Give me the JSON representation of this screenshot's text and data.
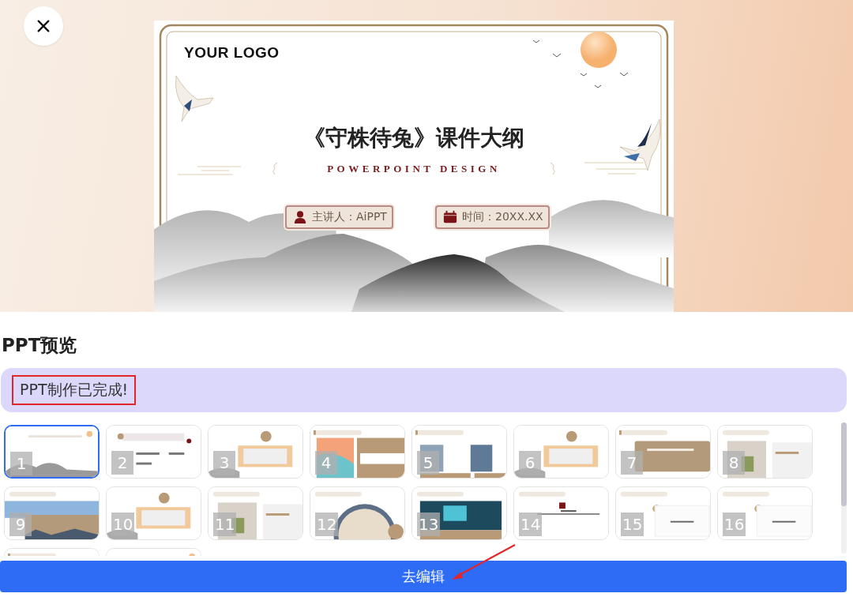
{
  "slide": {
    "logo": "YOUR LOGO",
    "title": "《守株待兔》课件大纲",
    "subtitle": "POWERPOINT DESIGN",
    "presenter": "主讲人：AiPPT",
    "time": "时间：20XX.XX"
  },
  "section_title": "PPT预览",
  "status_message": {
    "text": "PPT制作已完成!",
    "annotated": true
  },
  "thumbnails": [
    {
      "number": "1",
      "selected": true
    },
    {
      "number": "2",
      "selected": false
    },
    {
      "number": "3",
      "selected": false
    },
    {
      "number": "4",
      "selected": false
    },
    {
      "number": "5",
      "selected": false
    },
    {
      "number": "6",
      "selected": false
    },
    {
      "number": "7",
      "selected": false
    },
    {
      "number": "8",
      "selected": false
    },
    {
      "number": "9",
      "selected": false
    },
    {
      "number": "10",
      "selected": false
    },
    {
      "number": "11",
      "selected": false
    },
    {
      "number": "12",
      "selected": false
    },
    {
      "number": "13",
      "selected": false
    },
    {
      "number": "14",
      "selected": false
    },
    {
      "number": "15",
      "selected": false
    },
    {
      "number": "16",
      "selected": false
    },
    {
      "selected": false
    },
    {
      "selected": false
    }
  ],
  "edit_button": {
    "label": "去编辑"
  },
  "annotation_arrow": true
}
